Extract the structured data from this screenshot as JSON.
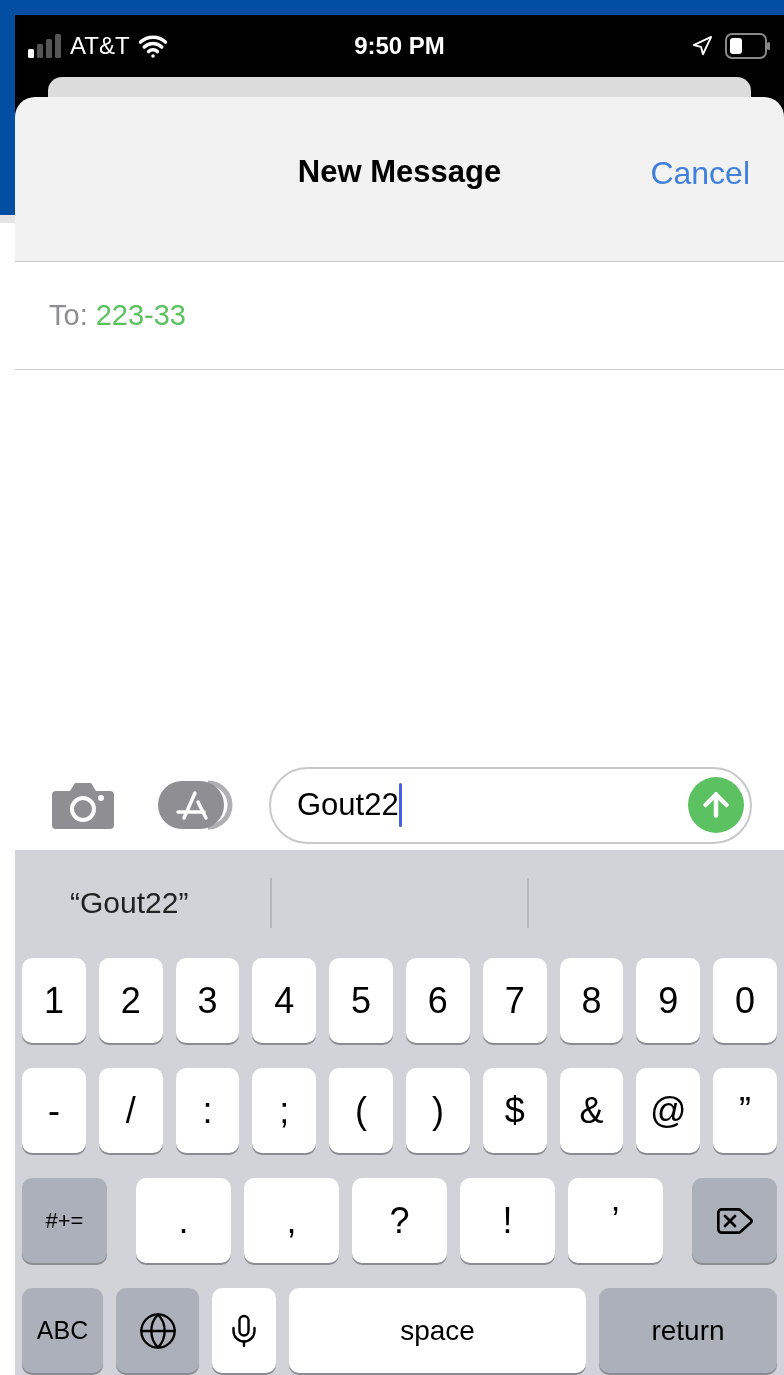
{
  "status_bar": {
    "carrier": "AT&T",
    "time": "9:50 PM"
  },
  "header": {
    "title": "New Message",
    "cancel": "Cancel"
  },
  "to": {
    "label": "To:",
    "recipient": "223-33"
  },
  "compose": {
    "value": "Gout22"
  },
  "keyboard": {
    "suggestions": [
      "“Gout22”"
    ],
    "number_row": [
      {
        "kind": "char",
        "label": "1"
      },
      {
        "kind": "char",
        "label": "2"
      },
      {
        "kind": "char",
        "label": "3"
      },
      {
        "kind": "char",
        "label": "4"
      },
      {
        "kind": "char",
        "label": "5"
      },
      {
        "kind": "char",
        "label": "6"
      },
      {
        "kind": "char",
        "label": "7"
      },
      {
        "kind": "char",
        "label": "8"
      },
      {
        "kind": "char",
        "label": "9"
      },
      {
        "kind": "char",
        "label": "0"
      }
    ],
    "symbol_row": [
      {
        "kind": "char",
        "label": "-"
      },
      {
        "kind": "char",
        "label": "/"
      },
      {
        "kind": "char",
        "label": ":"
      },
      {
        "kind": "char",
        "label": ";"
      },
      {
        "kind": "char",
        "label": "("
      },
      {
        "kind": "char",
        "label": ")"
      },
      {
        "kind": "char",
        "label": "$"
      },
      {
        "kind": "char",
        "label": "&"
      },
      {
        "kind": "char",
        "label": "@"
      },
      {
        "kind": "char",
        "label": "”"
      }
    ],
    "punctuation_row": [
      {
        "kind": "symbols",
        "label": "#+="
      },
      {
        "kind": "char",
        "label": "."
      },
      {
        "kind": "char",
        "label": ","
      },
      {
        "kind": "char",
        "label": "?"
      },
      {
        "kind": "char",
        "label": "!"
      },
      {
        "kind": "char",
        "label": "’"
      },
      {
        "kind": "delete"
      }
    ],
    "bottom_row": [
      {
        "kind": "abc",
        "label": "ABC"
      },
      {
        "kind": "globe"
      },
      {
        "kind": "dictation"
      },
      {
        "kind": "space",
        "label": "space"
      },
      {
        "kind": "return",
        "label": "return"
      }
    ]
  }
}
